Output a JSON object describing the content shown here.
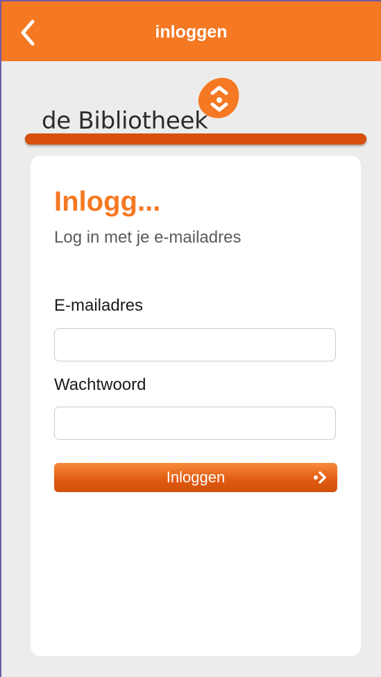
{
  "header": {
    "title": "inloggen",
    "back_icon": "chevron-left-icon"
  },
  "logo": {
    "text": "de Bibliotheek",
    "mark_icon": "bibliotheek-logo-icon"
  },
  "card": {
    "title": "Inlogg...",
    "subtitle": "Log in met je e-mailadres",
    "email_label": "E-mailadres",
    "email_value": "",
    "password_label": "Wachtwoord",
    "password_value": "",
    "login_button": "Inloggen",
    "login_icon": "arrow-right-icon"
  },
  "colors": {
    "accent": "#f57822",
    "logo_bar": "#d94f0e",
    "background": "#ececec"
  }
}
